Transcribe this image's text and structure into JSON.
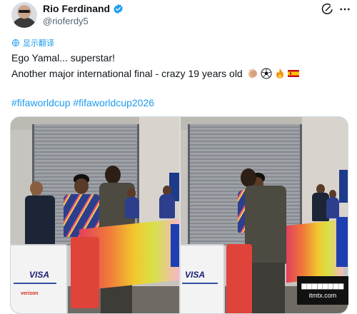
{
  "header": {
    "display_name": "Rio Ferdinand",
    "handle": "@rioferdy5",
    "verified_icon": "verified-badge-icon",
    "grok_icon": "grok-icon",
    "more_icon": "more-icon"
  },
  "translate": {
    "label": "显示翻译",
    "icon": "globe-icon"
  },
  "tweet": {
    "line1": "Ego Yamal... superstar!",
    "line2": "Another major international final - crazy 19 years old",
    "emojis": [
      "clapping-hands",
      "soccer-ball",
      "fire",
      "spain-flag"
    ],
    "hashtags": "#fifaworldcup #fifaworldcup2026"
  },
  "media": {
    "photo_left": {
      "banner_text": "VISA",
      "sponsor_text": "verizon"
    },
    "photo_right": {
      "banner_text": "VISA"
    }
  },
  "watermark": {
    "top": "▆▆▆▆▆▆▆▆",
    "bottom": "itmtx.com"
  },
  "colors": {
    "accent": "#1d9bf0",
    "text": "#0f1419",
    "muted": "#536471"
  }
}
